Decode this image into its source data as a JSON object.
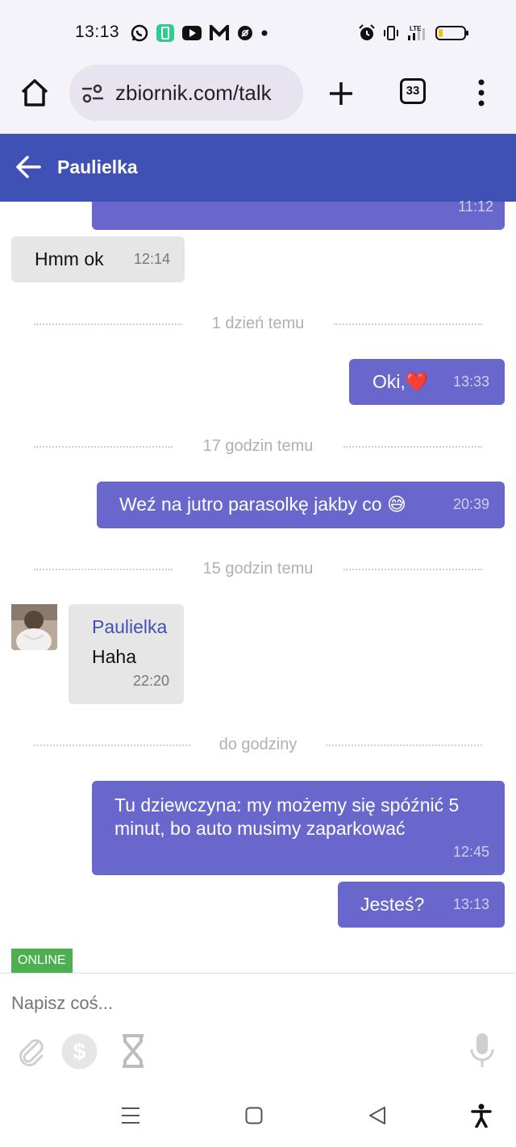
{
  "status": {
    "time": "13:13"
  },
  "browser": {
    "url": "zbiornik.com/talk",
    "tab_count": "33"
  },
  "chat": {
    "title": "Paulielka"
  },
  "messages": {
    "partial_out": {
      "time": "11:12"
    },
    "m1": {
      "text": "Hmm ok",
      "time": "12:14"
    },
    "m2": {
      "text": "Oki,❤️",
      "time": "13:33"
    },
    "m3": {
      "text": "Weź na jutro parasolkę jakby co 😅",
      "time": "20:39"
    },
    "m4": {
      "sender": "Paulielka",
      "text": "Haha",
      "time": "22:20"
    },
    "m5": {
      "line1": "Tu dziewczyna: my możemy się spóźnić 5",
      "line2": "minut, bo auto musimy zaparkować",
      "time": "12:45"
    },
    "m6": {
      "text": "Jesteś?",
      "time": "13:13"
    }
  },
  "dividers": {
    "d1": "1 dzień temu",
    "d2": "17 godzin temu",
    "d3": "15 godzin temu",
    "d4": "do godziny"
  },
  "presence": {
    "badge": "ONLINE"
  },
  "composer": {
    "placeholder": "Napisz coś..."
  },
  "colors": {
    "header": "#3f51b5",
    "outgoing_bubble": "#6966cc",
    "incoming_bubble": "#e6e6e6",
    "online": "#4caf50"
  }
}
